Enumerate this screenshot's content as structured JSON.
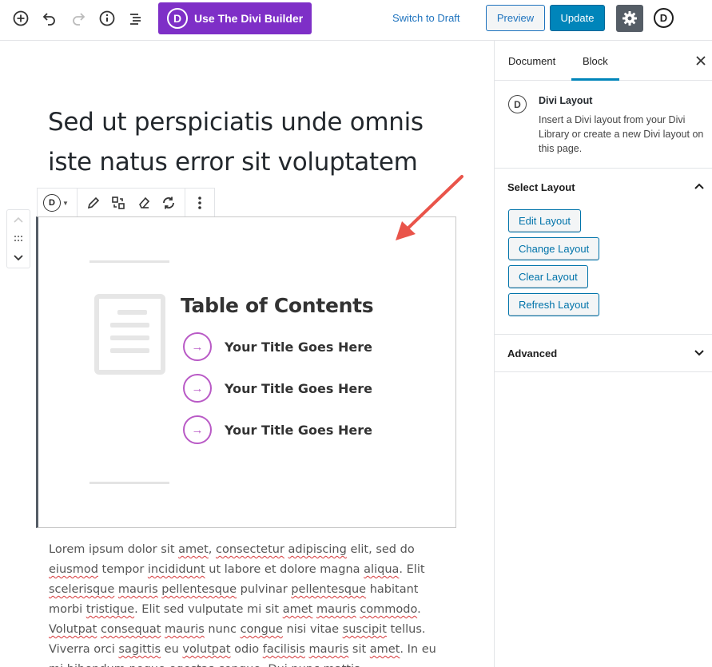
{
  "toolbar": {
    "add_icon": "plus-circle-icon",
    "undo_icon": "undo-icon",
    "redo_icon": "redo-icon",
    "info_icon": "info-icon",
    "outline_icon": "list-view-icon",
    "divi_builder_label": "Use The Divi Builder",
    "divi_logo_letter": "D",
    "switch_draft_label": "Switch to Draft",
    "preview_label": "Preview",
    "update_label": "Update",
    "settings_icon": "gear-icon",
    "divi_icon_letter": "D"
  },
  "editor": {
    "post_title": "Sed ut perspiciatis unde omnis iste natus error sit voluptatem",
    "block_toolbar": {
      "divi_letter": "D"
    },
    "layout": {
      "toc_title": "Table of Contents",
      "items": [
        {
          "label": "Your Title Goes Here",
          "arrow": "→"
        },
        {
          "label": "Your Title Goes Here",
          "arrow": "→"
        },
        {
          "label": "Your Title Goes Here",
          "arrow": "→"
        }
      ]
    },
    "paragraph_words": [
      [
        "Lorem ipsum dolor sit ",
        false
      ],
      [
        "amet",
        true
      ],
      [
        ", ",
        false
      ],
      [
        "consectetur",
        true
      ],
      [
        " ",
        false
      ],
      [
        "adipiscing",
        true
      ],
      [
        " elit, sed do ",
        false
      ],
      [
        "eiusmod",
        true
      ],
      [
        " tempor ",
        false
      ],
      [
        "incididunt",
        true
      ],
      [
        " ut labore et dolore magna ",
        false
      ],
      [
        "aliqua",
        true
      ],
      [
        ". Elit ",
        false
      ],
      [
        "scelerisque",
        true
      ],
      [
        " ",
        false
      ],
      [
        "mauris",
        true
      ],
      [
        " ",
        false
      ],
      [
        "pellentesque",
        true
      ],
      [
        " pulvinar ",
        false
      ],
      [
        "pellentesque",
        true
      ],
      [
        " habitant morbi ",
        false
      ],
      [
        "tristique",
        true
      ],
      [
        ". Elit sed vulputate mi sit ",
        false
      ],
      [
        "amet",
        true
      ],
      [
        " ",
        false
      ],
      [
        "mauris",
        true
      ],
      [
        " ",
        false
      ],
      [
        "commodo",
        true
      ],
      [
        ". ",
        false
      ],
      [
        "Volutpat",
        true
      ],
      [
        " ",
        false
      ],
      [
        "consequat",
        true
      ],
      [
        " ",
        false
      ],
      [
        "mauris",
        true
      ],
      [
        " nunc ",
        false
      ],
      [
        "congue",
        true
      ],
      [
        " nisi vitae ",
        false
      ],
      [
        "suscipit",
        true
      ],
      [
        " tellus. Viverra orci ",
        false
      ],
      [
        "sagittis",
        true
      ],
      [
        " eu ",
        false
      ],
      [
        "volutpat",
        true
      ],
      [
        " odio ",
        false
      ],
      [
        "facilisis",
        true
      ],
      [
        " ",
        false
      ],
      [
        "mauris",
        true
      ],
      [
        " sit ",
        false
      ],
      [
        "amet",
        true
      ],
      [
        ". In eu mi ",
        false
      ],
      [
        "bibendum",
        true
      ],
      [
        " ",
        false
      ],
      [
        "neque",
        true
      ],
      [
        " ",
        false
      ],
      [
        "egestas",
        true
      ],
      [
        " ",
        false
      ],
      [
        "congue",
        true
      ],
      [
        ". Dui nunc mattis",
        false
      ]
    ]
  },
  "sidebar": {
    "tab_document": "Document",
    "tab_block": "Block",
    "close_icon": "close-icon",
    "block_name": "Divi Layout",
    "block_letter": "D",
    "block_description": "Insert a Divi layout from your Divi Library or create a new Divi layout on this page.",
    "select_layout_title": "Select Layout",
    "buttons": {
      "edit": "Edit Layout",
      "change": "Change Layout",
      "clear": "Clear Layout",
      "refresh": "Refresh Layout"
    },
    "advanced_title": "Advanced"
  },
  "colors": {
    "divi_purple": "#7e2fc7",
    "primary_blue": "#0085ba",
    "link_blue": "#1e73be",
    "toc_accent": "#b95ac6",
    "annotation_arrow": "#e9544a"
  }
}
